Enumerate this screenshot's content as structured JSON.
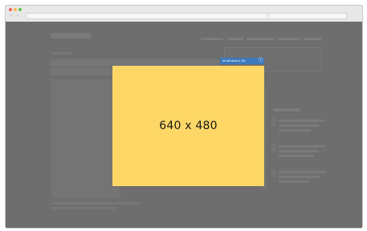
{
  "browser": {
    "address_bar_value": "",
    "nav_back_icon": "chevron-left",
    "nav_forward_icon": "chevron-right",
    "search_icon": "magnifier",
    "traffic_lights": [
      "#f26358",
      "#f5bf4f",
      "#5fc553"
    ]
  },
  "ad": {
    "dimension_label": "640 x 480",
    "adchoices_label": "Ad will close in 10s",
    "adchoices_icon": "info-icon",
    "background_color": "#fed766",
    "badge_color": "#3d79bd"
  },
  "overlay": {
    "dim_color": "#6b6b6b"
  }
}
